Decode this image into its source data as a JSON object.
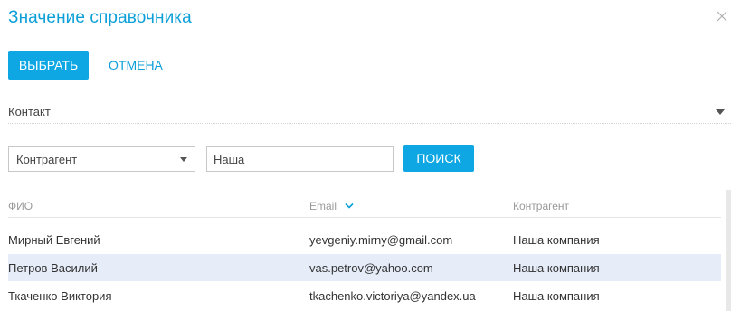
{
  "dialog": {
    "title": "Значение справочника"
  },
  "toolbar": {
    "select_label": "ВЫБРАТЬ",
    "cancel_label": "ОТМЕНА"
  },
  "lookup": {
    "selected": "Контакт"
  },
  "filter": {
    "column_selected": "Контрагент",
    "value": "Наша",
    "search_label": "ПОИСК"
  },
  "grid": {
    "columns": [
      {
        "label": "ФИО"
      },
      {
        "label": "Email",
        "sorted": "desc"
      },
      {
        "label": "Контрагент"
      }
    ],
    "rows": [
      {
        "name": "Мирный Евгений",
        "email": "yevgeniy.mirny@gmail.com",
        "account": "Наша компания",
        "selected": false
      },
      {
        "name": "Петров Василий",
        "email": "vas.petrov@yahoo.com",
        "account": "Наша компания",
        "selected": true
      },
      {
        "name": "Ткаченко Виктория",
        "email": "tkachenko.victoriya@yandex.ua",
        "account": "Наша компания",
        "selected": false
      }
    ]
  },
  "colors": {
    "accent": "#0ea7e4",
    "title": "#0c9fd8",
    "selected_row": "#e6edf9"
  },
  "icons": {
    "close": "close-icon",
    "sort": "chevron-down-icon",
    "dropdown": "caret-down-icon"
  }
}
